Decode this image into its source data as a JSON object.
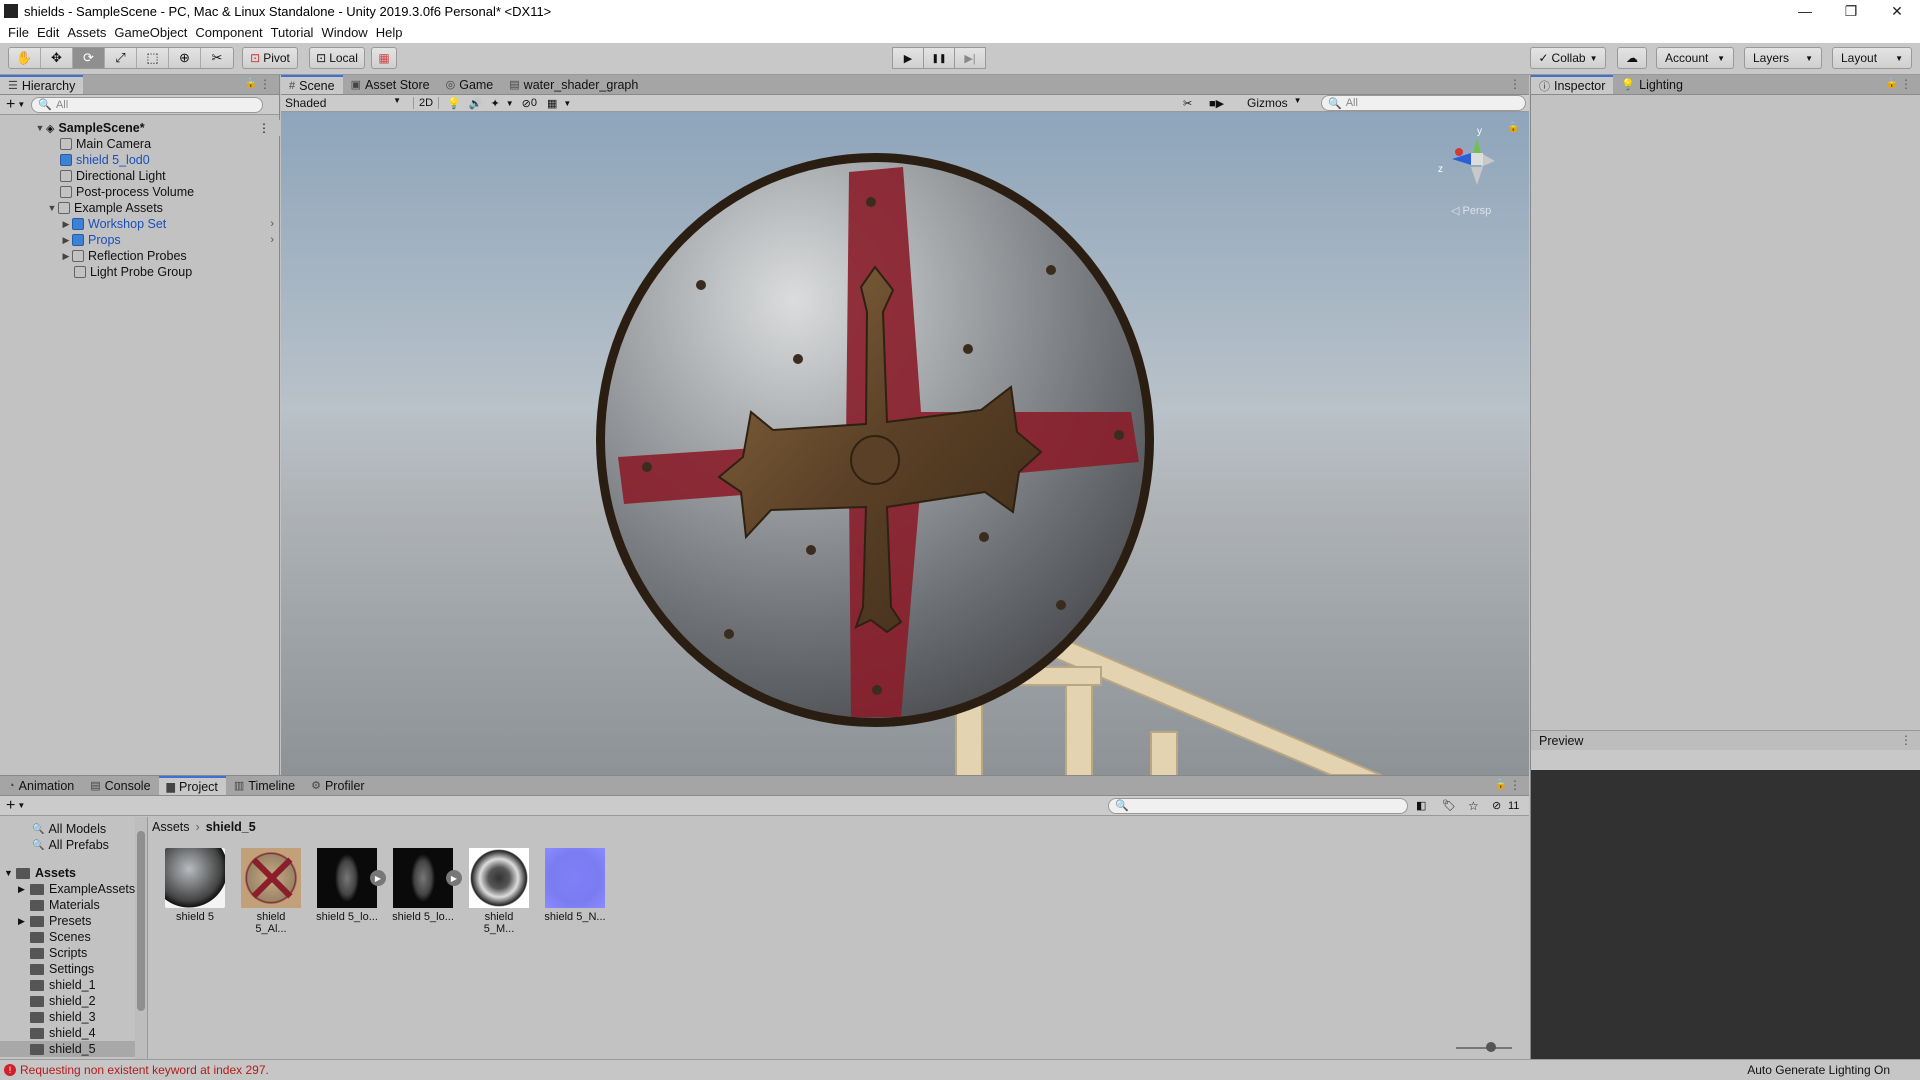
{
  "window": {
    "title": "shields - SampleScene - PC, Mac & Linux Standalone - Unity 2019.3.0f6 Personal* <DX11>",
    "controls": [
      "—",
      "❐",
      "✕"
    ]
  },
  "menu": [
    "File",
    "Edit",
    "Assets",
    "GameObject",
    "Component",
    "Tutorial",
    "Window",
    "Help"
  ],
  "toolbar": {
    "pivot": "Pivot",
    "local": "Local",
    "collab": "Collab",
    "account": "Account",
    "layers": "Layers",
    "layout": "Layout",
    "play_icons": [
      "▶",
      "❚❚",
      "▶|"
    ]
  },
  "hierarchy": {
    "tab": "Hierarchy",
    "search_placeholder": "All",
    "scene": "SampleScene*",
    "items": [
      {
        "label": "Main Camera"
      },
      {
        "label": "shield 5_lod0"
      },
      {
        "label": "Directional Light"
      },
      {
        "label": "Post-process Volume"
      },
      {
        "label": "Example Assets"
      },
      {
        "label": "Workshop Set"
      },
      {
        "label": "Props"
      },
      {
        "label": "Reflection Probes"
      },
      {
        "label": "Light Probe Group"
      }
    ]
  },
  "scene_tabs": [
    "Scene",
    "Asset Store",
    "Game",
    "water_shader_graph"
  ],
  "scene_toolbar": {
    "shading": "Shaded",
    "mode_2d": "2D",
    "hidden_count": "0",
    "gizmos": "Gizmos",
    "search_placeholder": "All",
    "persp": "◁ Persp",
    "axis_y": "y",
    "axis_z": "z"
  },
  "inspector": {
    "tabs": [
      "Inspector",
      "Lighting"
    ],
    "preview": "Preview"
  },
  "bottom_tabs": [
    "Animation",
    "Console",
    "Project",
    "Timeline",
    "Profiler"
  ],
  "project": {
    "breadcrumb": [
      "Assets",
      "shield_5"
    ],
    "favorites": [
      "All Models",
      "All Prefabs"
    ],
    "root": "Assets",
    "folders": [
      "ExampleAssets",
      "Materials",
      "Presets",
      "Scenes",
      "Scripts",
      "Settings",
      "shield_1",
      "shield_2",
      "shield_3",
      "shield_4",
      "shield_5"
    ],
    "hidden_count": "11",
    "assets": [
      {
        "name": "shield 5"
      },
      {
        "name": "shield 5_Al..."
      },
      {
        "name": "shield 5_lo..."
      },
      {
        "name": "shield 5_lo..."
      },
      {
        "name": "shield 5_M..."
      },
      {
        "name": "shield 5_N..."
      }
    ]
  },
  "status": {
    "error": "Requesting non existent keyword at index 297.",
    "lighting": "Auto Generate Lighting On"
  },
  "colors": {
    "accent": "#3a72d8",
    "shield_red": "#8a1e2a",
    "shield_metal": "#8d8f92",
    "cross_bronze": "#6a5030"
  }
}
